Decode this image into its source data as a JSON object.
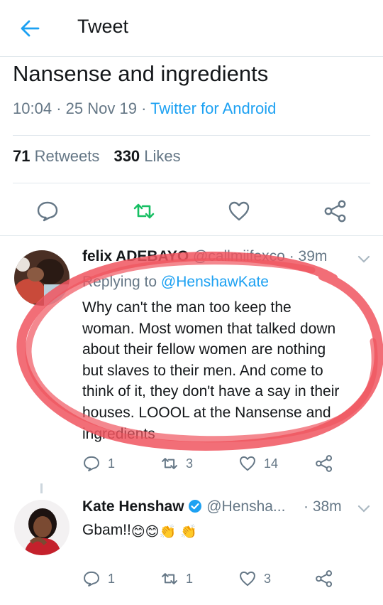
{
  "header": {
    "title": "Tweet",
    "back_icon": "arrow-left-icon"
  },
  "tweet": {
    "text": "Nansense and ingredients",
    "time": "10:04",
    "date": "25 Nov 19",
    "source": "Twitter for Android",
    "retweets": "71",
    "retweets_label": "Retweets",
    "likes": "330",
    "likes_label": "Likes"
  },
  "replies": [
    {
      "name": "felix ADEBAYO",
      "handle": "@callmiifexco",
      "time": "· 39m",
      "replying_prefix": "Replying to",
      "replying_to": "@HenshawKate",
      "lines": [
        "Why can't the man too keep the",
        "woman. Most women that talked down",
        "about their fellow women are nothing",
        "but slaves to their men. And come to",
        "think of it, they don't have a say in their",
        "houses. LOOOL at the Nansense and",
        "ingredients"
      ],
      "reply_count": "1",
      "retweet_count": "3",
      "like_count": "14"
    },
    {
      "name": "Kate Henshaw",
      "handle": "@Hensha...",
      "time": "· 38m",
      "text": "Gbam!!",
      "emojis": [
        "😊",
        "😊",
        "👏",
        "👏"
      ],
      "reply_count": "1",
      "retweet_count": "1",
      "like_count": "3"
    }
  ],
  "colors": {
    "accent": "#1da1f2",
    "retweet_green": "#17bf63",
    "secondary_text": "#657786",
    "annotation_red": "#f0555f"
  }
}
